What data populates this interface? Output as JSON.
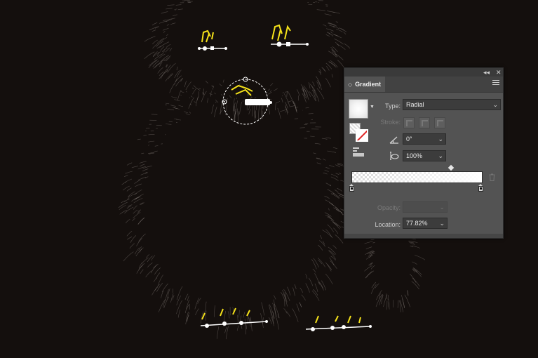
{
  "panel": {
    "title": "Gradient",
    "type_label": "Type:",
    "type_value": "Radial",
    "stroke_label": "Stroke:",
    "angle_value": "0°",
    "aspect_ratio_value": "100%",
    "opacity_label": "Opacity:",
    "opacity_value": "",
    "location_label": "Location:",
    "location_value": "77.82%"
  },
  "icons": {
    "collapse": "collapse-icon",
    "close": "close-icon",
    "menu": "panel-menu-icon",
    "angle": "angle-icon",
    "aspect": "aspect-ratio-icon",
    "reverse": "reverse-gradient-icon",
    "trash": "delete-stop-icon"
  },
  "colors": {
    "canvas_bg": "#140f0d",
    "anchor_yellow": "#f5e21a",
    "fur": "#b9b3ad",
    "panel_bg": "#535353"
  },
  "gradient": {
    "stops": [
      0,
      1
    ],
    "midpoint": 0.77
  }
}
